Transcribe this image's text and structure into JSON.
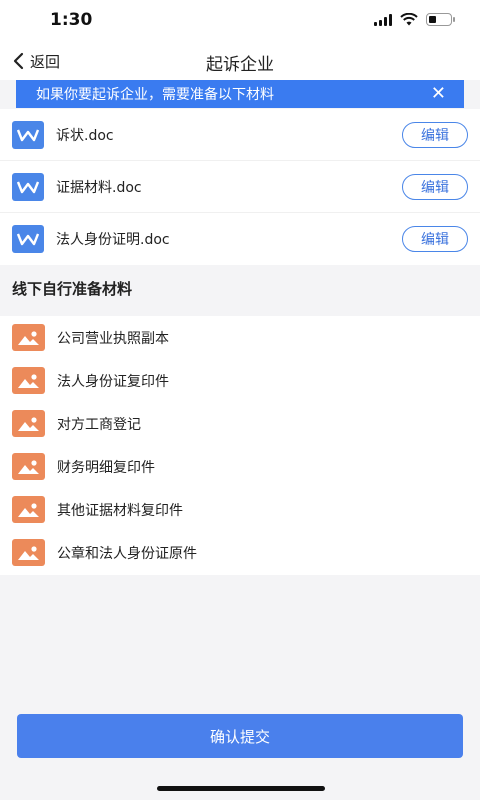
{
  "status_bar": {
    "time": "1:30"
  },
  "nav": {
    "back_label": "返回",
    "title": "起诉企业"
  },
  "notice": {
    "text": "如果你要起诉企业，需要准备以下材料",
    "close": "✕"
  },
  "documents": [
    {
      "name": "诉状.doc",
      "action": "编辑"
    },
    {
      "name": "证据材料.doc",
      "action": "编辑"
    },
    {
      "name": "法人身份证明.doc",
      "action": "编辑"
    }
  ],
  "offline_section": {
    "title": "线下自行准备材料",
    "items": [
      "公司营业执照副本",
      "法人身份证复印件",
      "对方工商登记",
      "财务明细复印件",
      "其他证据材料复印件",
      "公章和法人身份证原件"
    ]
  },
  "submit": {
    "label": "确认提交"
  },
  "colors": {
    "accent": "#3a7bf0",
    "word_icon": "#4a86e8",
    "image_icon": "#ec8a5a"
  }
}
